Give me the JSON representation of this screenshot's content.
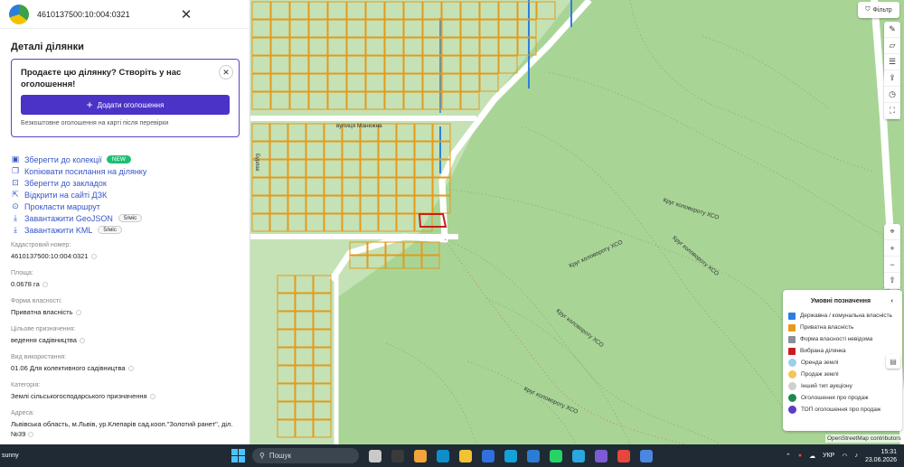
{
  "panel": {
    "parcel_id": "4610137500:10:004:0321",
    "details_title": "Деталі ділянки",
    "promo": {
      "title": "Продаєте цю ділянку? Створіть у нас оголошення!",
      "button": "Додати оголошення",
      "note": "Безкоштовне оголошення на карті після перевірки"
    },
    "actions": [
      {
        "label": "Зберегти до колекції",
        "badge": "NEW",
        "icon": "collection-icon"
      },
      {
        "label": "Копіювати посилання на ділянку",
        "icon": "copy-icon"
      },
      {
        "label": "Зберегти до закладок",
        "icon": "bookmark-icon"
      },
      {
        "label": "Відкрити на сайті ДЗК",
        "icon": "external-link-icon"
      },
      {
        "label": "Прокласти маршрут",
        "icon": "route-pin-icon"
      },
      {
        "label": "Завантажити GeoJSON",
        "rate": "5/міс",
        "icon": "download-icon"
      },
      {
        "label": "Завантажити KML",
        "rate": "5/міс",
        "icon": "download-icon"
      }
    ],
    "fields": [
      {
        "label": "Кадастровий номер:",
        "value": "4610137500:10:004:0321"
      },
      {
        "label": "Площа:",
        "value": "0.0678 га"
      },
      {
        "label": "Форма власності:",
        "value": "Приватна власність"
      },
      {
        "label": "Цільове призначення:",
        "value": "ведення садівництва"
      },
      {
        "label": "Вид використання:",
        "value": "01.06 Для колективного садівництва"
      },
      {
        "label": "Категорія:",
        "value": "Землі сільськогосподарського призначення"
      },
      {
        "label": "Адреса:",
        "value": "Львівська область, м.Львів, ур.Клепарів сад.кооп.\"Золотий ранет\", діл. №39"
      }
    ]
  },
  "map": {
    "filter_label": "Фільтр",
    "street_label": "вулиця Манежна",
    "street_label_2": "Бурлак",
    "route_labels": [
      "Круг коловороту ХСО",
      "Круг коловороту ХСО",
      "Круг коловороту ХСО",
      "Круг коловороту ХСО",
      "Круг коловороту ХСО"
    ],
    "attribution": "OpenStreetMap contributors",
    "legend": {
      "title": "Умовні позначення",
      "items": [
        {
          "label": "Державна / комунальна власність",
          "color": "#2f7de0",
          "kind": "square"
        },
        {
          "label": "Приватна власність",
          "color": "#e59a1a",
          "kind": "square"
        },
        {
          "label": "Форма власності невідома",
          "color": "#8a8f98",
          "kind": "square"
        },
        {
          "label": "Вибрана ділянка",
          "color": "#c81d1d",
          "kind": "square"
        },
        {
          "label": "Оренда землі",
          "color": "#9ad0e8",
          "kind": "circle"
        },
        {
          "label": "Продаж землі",
          "color": "#f3c55a",
          "kind": "circle"
        },
        {
          "label": "Інший тип аукціону",
          "color": "#cfcfcf",
          "kind": "circle"
        },
        {
          "label": "Оголошення про продаж",
          "color": "#1d8a4a",
          "kind": "circle"
        },
        {
          "label": "ТОП оголошення про продаж",
          "color": "#5b3cc4",
          "kind": "circle"
        }
      ]
    }
  },
  "taskbar": {
    "weather": "sunny",
    "search": "Пошук",
    "lang": "УКР",
    "time": "15:31",
    "date": "23.06.2026"
  }
}
